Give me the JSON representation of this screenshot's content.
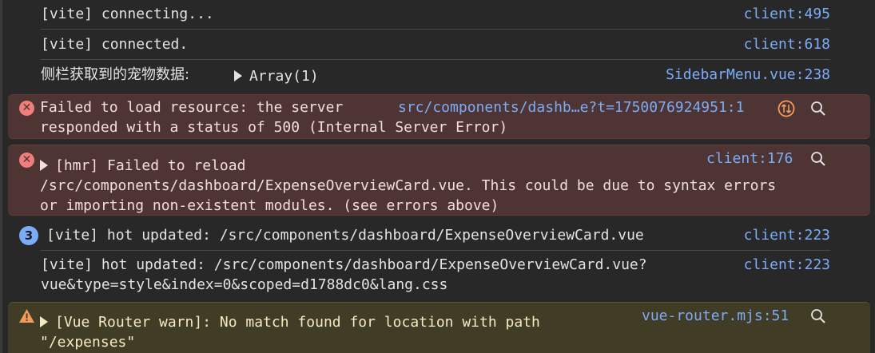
{
  "console": {
    "rows": [
      {
        "message": "[vite] connecting...",
        "source": "client:495"
      },
      {
        "message": "[vite] connected.",
        "source": "client:618"
      },
      {
        "message": "侧栏获取到的宠物数据:",
        "expandable_label": "Array(1)",
        "source": "SidebarMenu.vue:238"
      },
      {
        "message_line1": "Failed to load resource: the server",
        "message_line2": "responded with a status of 500 (Internal Server Error)",
        "source": "src/components/dashb…e?t=1750076924951:1"
      },
      {
        "message_line1": "[hmr] Failed to reload",
        "message_line2": "/src/components/dashboard/ExpenseOverviewCard.vue. This could be due to syntax errors",
        "message_line3": "or importing non-existent modules. (see errors above)",
        "source": "client:176"
      },
      {
        "count": "3",
        "message": "[vite] hot updated: /src/components/dashboard/ExpenseOverviewCard.vue",
        "source": "client:223"
      },
      {
        "message_line1": "[vite] hot updated: /src/components/dashboard/ExpenseOverviewCard.vue?",
        "message_line2": "vue&type=style&index=0&scoped=d1788dc0&lang.css",
        "source": "client:223"
      },
      {
        "message_line1": "[Vue Router warn]: No match found for location with path",
        "message_line2": "\"/expenses\"",
        "source": "vue-router.mjs:51"
      }
    ]
  },
  "colors": {
    "background": "#282828",
    "error_background": "#4e3534",
    "warning_background": "#413c25",
    "link": "#7cacf8",
    "error_icon": "#f07e7a",
    "warning_icon": "#f29b5a"
  },
  "icons": [
    "error-icon",
    "warning-icon",
    "expand-triangle-icon",
    "search-icon",
    "network-icon"
  ]
}
